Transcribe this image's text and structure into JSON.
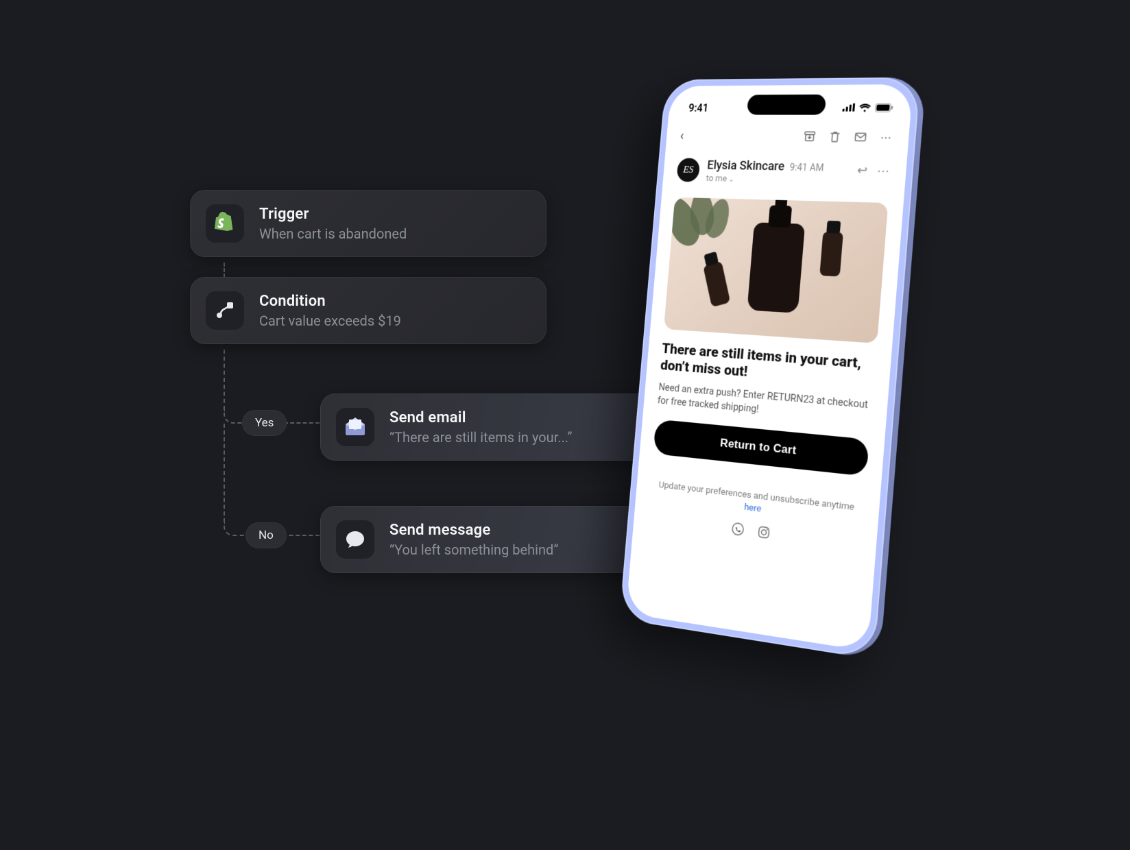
{
  "flow": {
    "trigger": {
      "title": "Trigger",
      "sub": "When cart is abandoned"
    },
    "condition": {
      "title": "Condition",
      "sub": "Cart value exceeds $19"
    },
    "email": {
      "title": "Send email",
      "sub": "“There are still items in your...”"
    },
    "message": {
      "title": "Send message",
      "sub": "“You left something behind”"
    },
    "branch_yes": "Yes",
    "branch_no": "No"
  },
  "phone": {
    "status_time": "9:41",
    "mail": {
      "sender": "Elysia Skincare",
      "time": "9:41 AM",
      "to_line": "to me",
      "avatar_initials": "ES",
      "headline": "There are still items in your cart, don’t miss out!",
      "body_text": "Need an extra push? Enter RETURN23 at checkout for free tracked shipping!",
      "cta": "Return to Cart",
      "footer_pre": "Update your preferences and unsubscribe anytime ",
      "footer_link": "here"
    }
  }
}
